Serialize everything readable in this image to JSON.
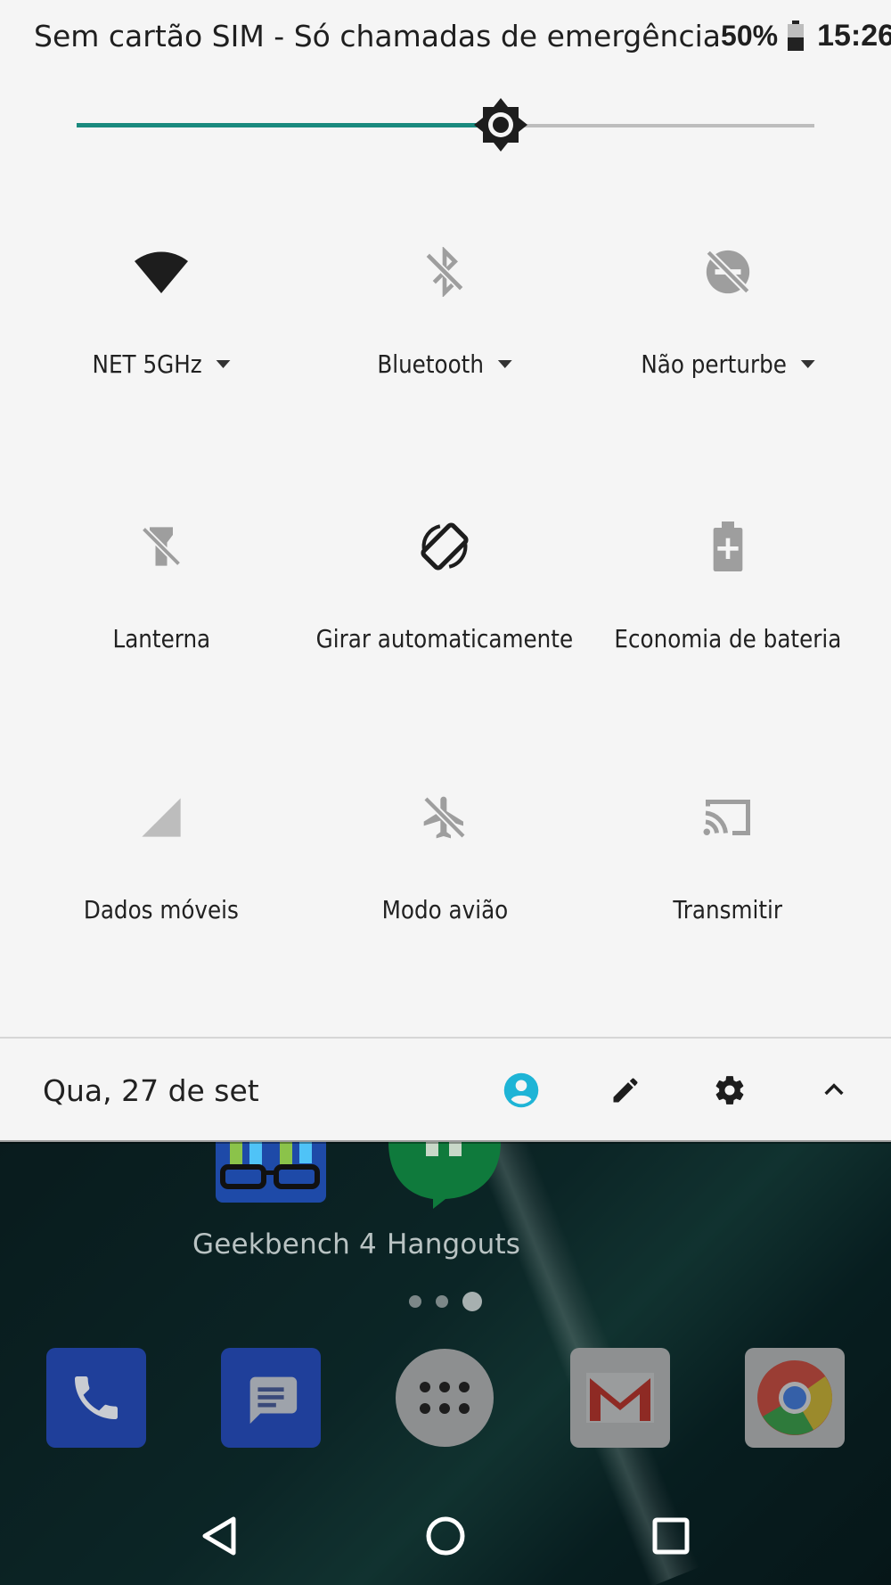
{
  "status_bar": {
    "carrier_text": "Sem cartão SIM - Só chamadas de emergência",
    "battery_percent": "50%",
    "time": "15:26"
  },
  "brightness": {
    "level": 0.575
  },
  "tiles": [
    {
      "label": "NET 5GHz",
      "icon": "wifi-icon",
      "has_dropdown": true,
      "active": true
    },
    {
      "label": "Bluetooth",
      "icon": "bluetooth-off-icon",
      "has_dropdown": true,
      "active": false
    },
    {
      "label": "Não perturbe",
      "icon": "do-not-disturb-off-icon",
      "has_dropdown": true,
      "active": false
    },
    {
      "label": "Lanterna",
      "icon": "flashlight-off-icon",
      "has_dropdown": false,
      "active": false
    },
    {
      "label": "Girar automaticamente",
      "icon": "auto-rotate-icon",
      "has_dropdown": false,
      "active": true
    },
    {
      "label": "Economia de bateria",
      "icon": "battery-saver-icon",
      "has_dropdown": false,
      "active": false
    },
    {
      "label": "Dados móveis",
      "icon": "mobile-data-icon",
      "has_dropdown": false,
      "active": false
    },
    {
      "label": "Modo avião",
      "icon": "airplane-mode-off-icon",
      "has_dropdown": false,
      "active": false
    },
    {
      "label": "Transmitir",
      "icon": "cast-icon",
      "has_dropdown": false,
      "active": false
    }
  ],
  "footer": {
    "date": "Qua, 27 de set",
    "buttons": [
      "user-icon",
      "edit-icon",
      "settings-icon",
      "collapse-icon"
    ]
  },
  "home_screen": {
    "apps": [
      {
        "label": "Geekbench 4",
        "icon": "geekbench-icon"
      },
      {
        "label": "Hangouts",
        "icon": "hangouts-icon"
      }
    ],
    "dock": [
      "phone-icon",
      "messages-icon",
      "app-drawer-icon",
      "gmail-icon",
      "chrome-icon"
    ],
    "page_indicator": {
      "pages": 3,
      "active": 3
    }
  },
  "nav_bar": [
    "back-icon",
    "home-icon",
    "recents-icon"
  ],
  "colors": {
    "accent": "#1a8a7e",
    "shade_background": "#f5f5f5",
    "user_icon": "#1eb4d6",
    "inactive_icon": "#9e9e9e",
    "active_icon": "#212121"
  }
}
